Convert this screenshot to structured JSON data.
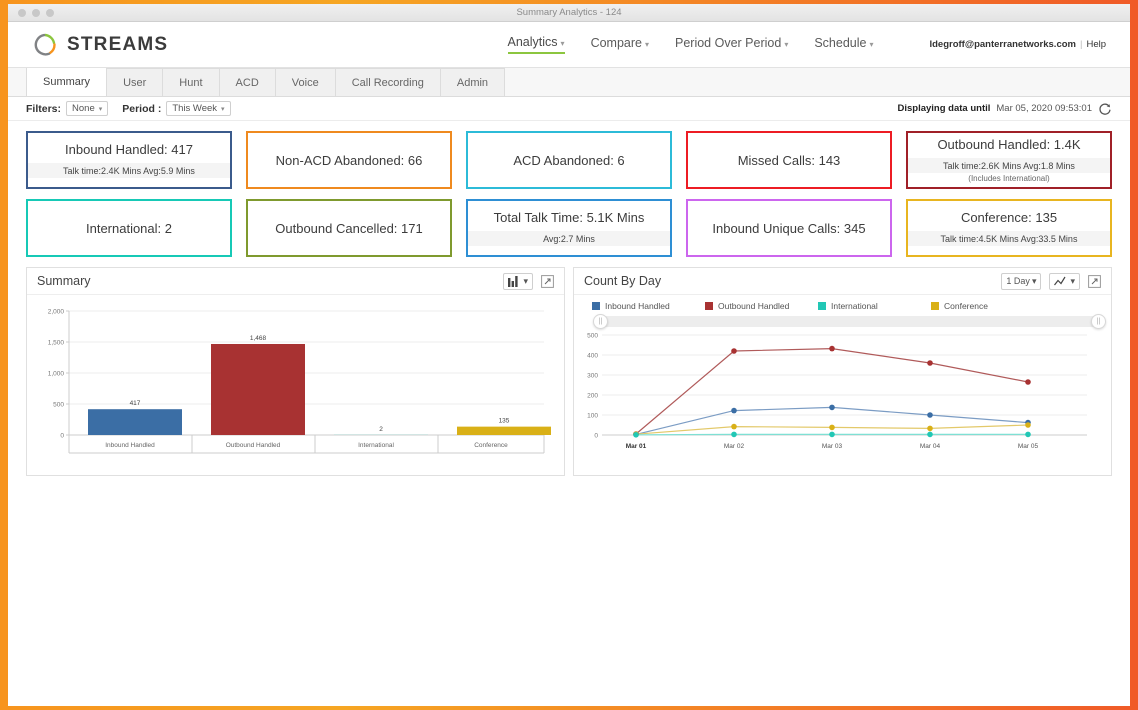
{
  "window": {
    "title": "Summary Analytics - 124"
  },
  "header": {
    "brand": "STREAMS",
    "nav": [
      {
        "label": "Analytics",
        "active": true
      },
      {
        "label": "Compare",
        "active": false
      },
      {
        "label": "Period Over Period",
        "active": false
      },
      {
        "label": "Schedule",
        "active": false
      }
    ],
    "user_email": "ldegroff@panterranetworks.com",
    "help_label": "Help"
  },
  "tabs": [
    {
      "label": "Summary",
      "active": true
    },
    {
      "label": "User",
      "active": false
    },
    {
      "label": "Hunt",
      "active": false
    },
    {
      "label": "ACD",
      "active": false
    },
    {
      "label": "Voice",
      "active": false
    },
    {
      "label": "Call Recording",
      "active": false
    },
    {
      "label": "Admin",
      "active": false
    }
  ],
  "filters": {
    "filters_label": "Filters:",
    "filters_value": "None",
    "period_label": "Period :",
    "period_value": "This Week",
    "updated_label": "Displaying data until",
    "updated_value": "Mar 05, 2020 09:53:01",
    "refresh_icon": "refresh-icon"
  },
  "cards": [
    {
      "title": "Inbound Handled: 417",
      "sub": "Talk time:2.4K Mins  Avg:5.9 Mins",
      "note": "",
      "color": "#3b5b8c"
    },
    {
      "title": "Non-ACD Abandoned: 66",
      "sub": "",
      "note": "",
      "color": "#ef8a1f"
    },
    {
      "title": "ACD Abandoned: 6",
      "sub": "",
      "note": "",
      "color": "#2cbbd8"
    },
    {
      "title": "Missed Calls: 143",
      "sub": "",
      "note": "",
      "color": "#ed1c24"
    },
    {
      "title": "Outbound Handled: 1.4K",
      "sub": "Talk time:2.6K Mins  Avg:1.8 Mins",
      "note": "(Includes International)",
      "color": "#a02028"
    },
    {
      "title": "International: 2",
      "sub": "",
      "note": "",
      "color": "#17c9b6"
    },
    {
      "title": "Outbound Cancelled: 171",
      "sub": "",
      "note": "",
      "color": "#7f9a2e"
    },
    {
      "title": "Total Talk Time: 5.1K Mins",
      "sub": "Avg:2.7 Mins",
      "note": "",
      "color": "#2e8fd4"
    },
    {
      "title": "Inbound Unique Calls: 345",
      "sub": "",
      "note": "",
      "color": "#cc66ee"
    },
    {
      "title": "Conference: 135",
      "sub": "Talk time:4.5K Mins  Avg:33.5 Mins",
      "note": "",
      "color": "#e8b520"
    }
  ],
  "summary_panel": {
    "title": "Summary",
    "chart_type_icon": "bar-chart-icon",
    "expand_icon": "expand-icon"
  },
  "countbyday_panel": {
    "title": "Count By Day",
    "interval_value": "1 Day",
    "chart_type_icon": "line-chart-icon",
    "expand_icon": "expand-icon"
  },
  "chart_data": [
    {
      "type": "bar",
      "title": "Summary",
      "categories": [
        "Inbound Handled",
        "Outbound Handled",
        "International",
        "Conference"
      ],
      "values": [
        417,
        1468,
        2,
        135
      ],
      "labels": [
        "417",
        "1,468",
        "2",
        "135"
      ],
      "colors": [
        "#3b6ea5",
        "#a83232",
        "#22c7b5",
        "#d9b017"
      ],
      "xlabel": "",
      "ylabel": "",
      "ylim": [
        0,
        2000
      ],
      "yticks": [
        0,
        500,
        1000,
        1500,
        2000
      ],
      "ytick_labels": [
        "0",
        "500",
        "1,000",
        "1,500",
        "2,000"
      ],
      "grid": true,
      "legend": false
    },
    {
      "type": "line",
      "title": "Count By Day",
      "x": [
        "Mar 01",
        "Mar 02",
        "Mar 03",
        "Mar 04",
        "Mar 05"
      ],
      "series": [
        {
          "name": "Inbound Handled",
          "color": "#3b6ea5",
          "values": [
            3,
            122,
            138,
            100,
            62
          ]
        },
        {
          "name": "Outbound Handled",
          "color": "#a83232",
          "values": [
            5,
            420,
            432,
            360,
            265
          ]
        },
        {
          "name": "International",
          "color": "#22c7b5",
          "values": [
            1,
            3,
            3,
            3,
            3
          ]
        },
        {
          "name": "Conference",
          "color": "#d9b017",
          "values": [
            4,
            42,
            38,
            33,
            50
          ]
        }
      ],
      "ylim": [
        0,
        500
      ],
      "yticks": [
        0,
        100,
        200,
        300,
        400,
        500
      ],
      "ytick_labels": [
        "0",
        "100",
        "200",
        "300",
        "400",
        "500"
      ],
      "xlabel": "",
      "ylabel": "",
      "grid": true,
      "legend": true,
      "legend_position": "top"
    }
  ]
}
